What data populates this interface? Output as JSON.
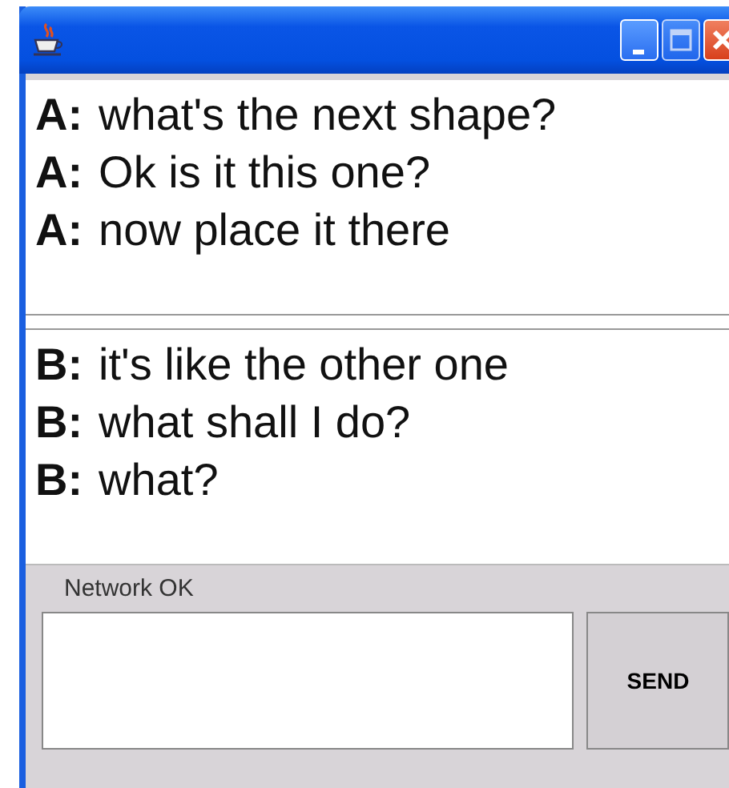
{
  "panels": [
    {
      "messages": [
        {
          "speaker": "A:",
          "text": "what's the next shape?"
        },
        {
          "speaker": "A:",
          "text": "Ok is it this one?"
        },
        {
          "speaker": "A:",
          "text": "now place it there"
        }
      ]
    },
    {
      "messages": [
        {
          "speaker": "B:",
          "text": "it's like the other one"
        },
        {
          "speaker": "B:",
          "text": "what shall I do?"
        },
        {
          "speaker": "B:",
          "text": "what?"
        }
      ]
    }
  ],
  "status": "Network OK",
  "send_button": "SEND"
}
